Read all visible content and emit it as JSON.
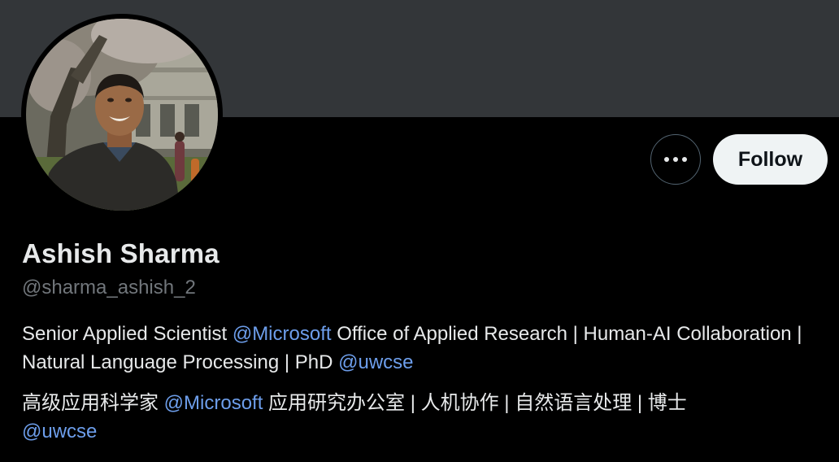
{
  "colors": {
    "banner": "#333639",
    "background": "#000000",
    "text": "#e7e9ea",
    "muted": "#71767b",
    "link": "#6d9eeb",
    "follow_bg": "#eff3f4",
    "follow_text": "#0f1419"
  },
  "profile": {
    "display_name": "Ashish Sharma",
    "handle": "@sharma_ashish_2",
    "avatar_icon": "profile-photo",
    "more_icon": "more-horizontal-icon",
    "follow_label": "Follow"
  },
  "bio_en": {
    "t1": "Senior Applied Scientist ",
    "m1": "@Microsoft",
    "t2": " Office of Applied Research | Human-AI Collaboration | Natural Language Processing | PhD ",
    "m2": "@uwcse"
  },
  "bio_zh": {
    "t1": "高级应用科学家 ",
    "m1": "@Microsoft",
    "t2": " 应用研究办公室 | 人机协作 | 自然语言处理 | 博士 ",
    "m2": "@uwcse"
  }
}
